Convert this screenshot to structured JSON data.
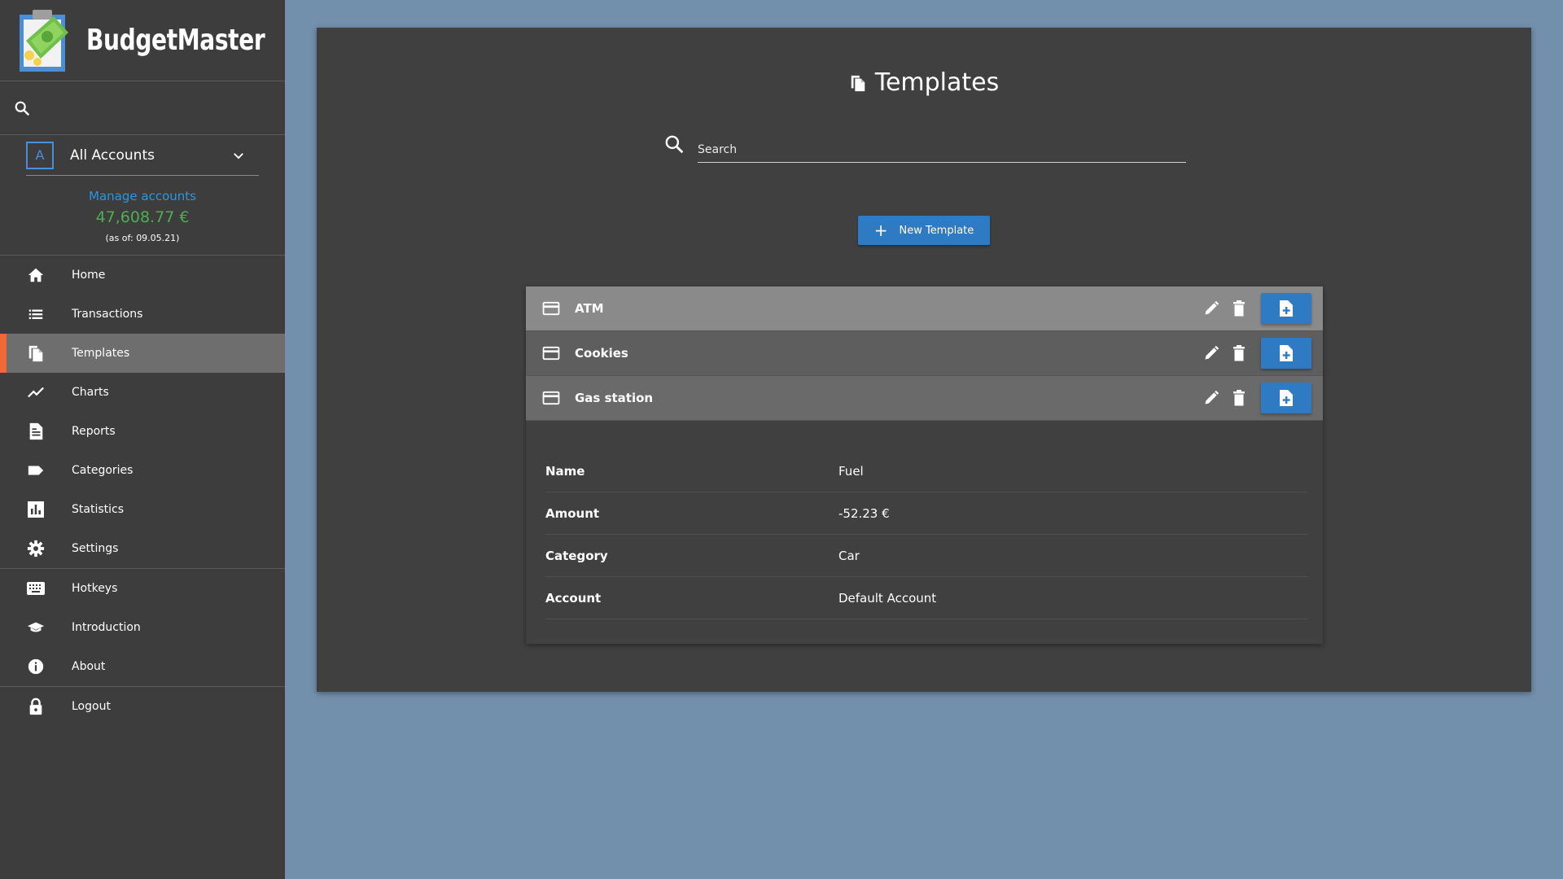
{
  "app": {
    "name": "BudgetMaster"
  },
  "sidebar": {
    "account": {
      "badge": "A",
      "selected": "All Accounts",
      "manage_label": "Manage accounts",
      "balance": "47,608.77 €",
      "as_of": "(as of: 09.05.21)"
    },
    "items": [
      {
        "label": "Home",
        "icon": "home-icon"
      },
      {
        "label": "Transactions",
        "icon": "list-icon"
      },
      {
        "label": "Templates",
        "icon": "file-copy-icon",
        "active": true
      },
      {
        "label": "Charts",
        "icon": "trending-up-icon"
      },
      {
        "label": "Reports",
        "icon": "description-icon"
      },
      {
        "label": "Categories",
        "icon": "label-icon"
      },
      {
        "label": "Statistics",
        "icon": "bar-chart-icon"
      },
      {
        "label": "Settings",
        "icon": "gear-icon"
      },
      {
        "label": "Hotkeys",
        "icon": "keyboard-icon"
      },
      {
        "label": "Introduction",
        "icon": "school-icon"
      },
      {
        "label": "About",
        "icon": "info-icon"
      },
      {
        "label": "Logout",
        "icon": "lock-icon"
      }
    ]
  },
  "main": {
    "title": "Templates",
    "search": {
      "placeholder": "Search",
      "value": ""
    },
    "new_button_label": "New Template",
    "templates": [
      {
        "name": "ATM"
      },
      {
        "name": "Cookies"
      },
      {
        "name": "Gas station"
      }
    ],
    "details": [
      {
        "key": "Name",
        "value": "Fuel"
      },
      {
        "key": "Amount",
        "value": "-52.23 €"
      },
      {
        "key": "Category",
        "value": "Car"
      },
      {
        "key": "Account",
        "value": "Default Account"
      }
    ]
  },
  "colors": {
    "accent": "#2e7bc4",
    "active_marker": "#f06a35",
    "balance": "#4caf50",
    "link": "#2a96e0",
    "background": "#728fab"
  }
}
